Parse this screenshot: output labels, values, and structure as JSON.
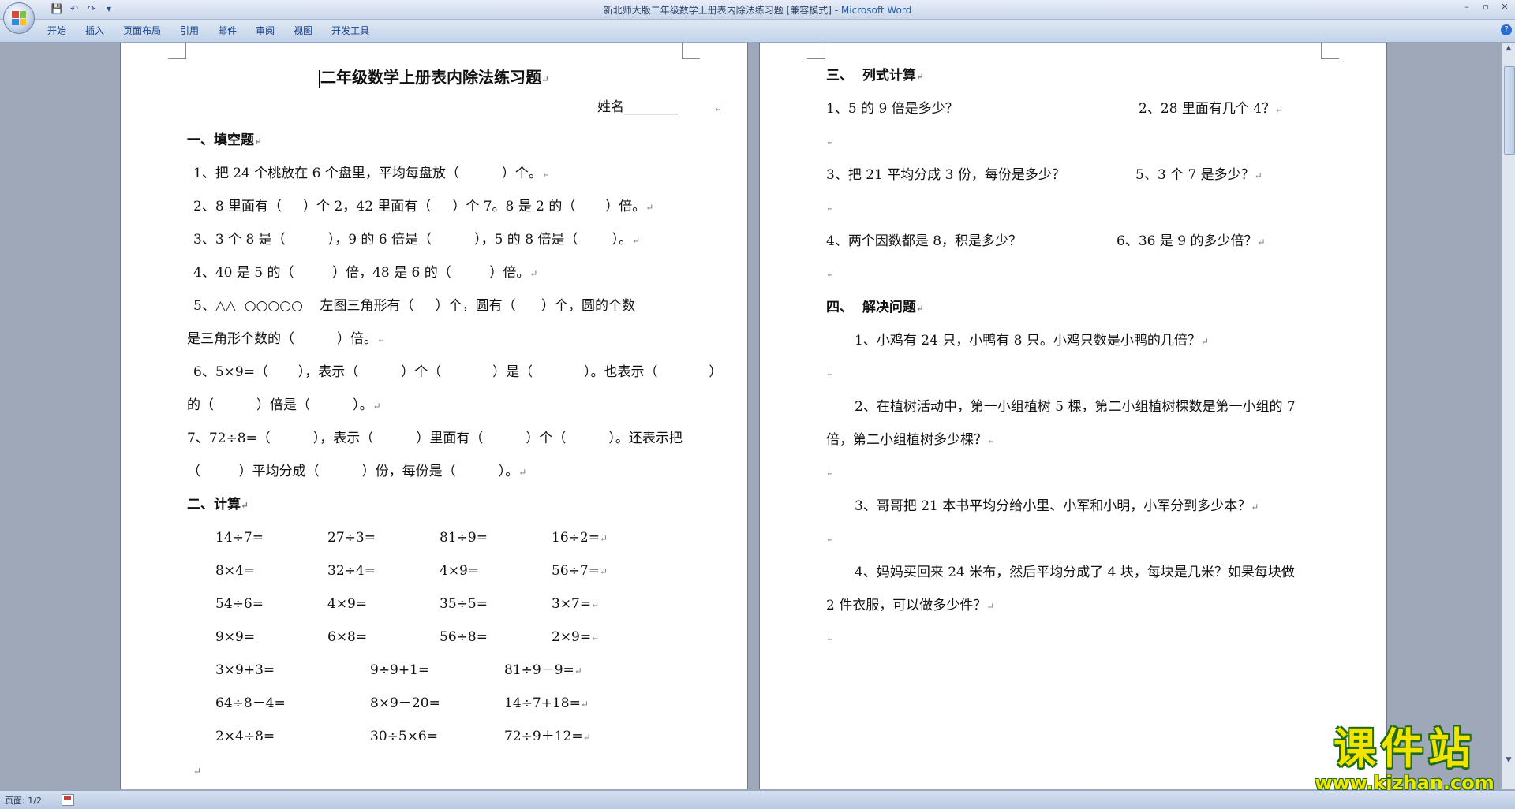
{
  "window": {
    "title_doc": "新北师大版二年级数学上册表内除法练习题 [兼容模式] - ",
    "title_app": "Microsoft Word",
    "minimize": "–",
    "restore": "▫",
    "close": "✕"
  },
  "qat": {
    "save": "💾",
    "undo": "↶",
    "redo": "↷",
    "more": "▾"
  },
  "tabs": [
    "开始",
    "插入",
    "页面布局",
    "引用",
    "邮件",
    "审阅",
    "视图",
    "开发工具"
  ],
  "help": "?",
  "page1": {
    "title": "二年级数学上册表内除法练习题",
    "name_line": "姓名________",
    "section1": "一、填空题",
    "q1": "1、把 24 个桃放在 6 个盘里，平均每盘放（          ）个。",
    "q2": "2、8 里面有（     ）个 2，42 里面有（     ）个 7。8 是 2 的（       ）倍。",
    "q3": "3、3 个 8 是（          ），9 的 6 倍是（          ），5 的 8 倍是（        ）。",
    "q4": "4、40 是 5 的（         ）倍，48 是 6 的（         ）倍。",
    "q5a": "5、△△  ○○○○○    左图三角形有（     ）个，圆有（      ）个，圆的个数",
    "q5b": "是三角形个数的（          ）倍。",
    "q6a": "6、5×9=（       ），表示（          ）个（            ）是（            ）。也表示（            ）",
    "q6b": "的（          ）倍是（          ）。",
    "q7a": "7、72÷8=（          ），表示（          ）里面有（          ）个（          ）。还表示把",
    "q7b": "（         ）平均分成（          ）份，每份是（          ）。",
    "section2": "二、计算",
    "calc_rows_a": [
      [
        "14÷7=",
        "27÷3=",
        "81÷9=",
        "16÷2="
      ],
      [
        "8×4=",
        "32÷4=",
        "4×9=",
        "56÷7="
      ],
      [
        "54÷6=",
        "4×9=",
        "35÷5=",
        "3×7="
      ],
      [
        "9×9=",
        "6×8=",
        "56÷8=",
        "2×9="
      ]
    ],
    "calc_rows_b": [
      [
        "3×9+3=",
        "9÷9+1=",
        "81÷9－9="
      ],
      [
        "64÷8－4=",
        "8×9－20=",
        "14÷7+18="
      ],
      [
        "2×4÷8=",
        "30÷5×6=",
        "72÷9＋12="
      ]
    ],
    "pilcrow": "↵"
  },
  "page2": {
    "section3": "三、  列式计算",
    "p1": "1、5 的 9 倍是多少？",
    "p2": "2、28 里面有几个 4？",
    "p3": "3、把 21 平均分成 3 份，每份是多少？",
    "p5": "5、3 个 7 是多少？",
    "p4": "4、两个因数都是 8，积是多少？",
    "p6": "6、36 是 9 的多少倍？",
    "section4": "四、  解决问题",
    "w1": "1、小鸡有 24 只，小鸭有 8 只。小鸡只数是小鸭的几倍？",
    "w2a": "2、在植树活动中，第一小组植树 5 棵，第二小组植树棵数是第一小组的 7",
    "w2b": "倍，第二小组植树多少棵？",
    "w3": "3、哥哥把 21 本书平均分给小里、小军和小明，小军分到多少本？",
    "w4a": "4、妈妈买回来 24 米布，然后平均分成了 4 块，每块是几米？如果每块做",
    "w4b": "2 件衣服，可以做多少件？"
  },
  "status": {
    "page": "页面: 1/2"
  },
  "watermark": {
    "title": "课件站",
    "url": "www.kjzhan.com"
  },
  "colors": {
    "office_logo": [
      "#e2462c",
      "#7cc243",
      "#2f8ae0",
      "#f7c21a"
    ]
  }
}
